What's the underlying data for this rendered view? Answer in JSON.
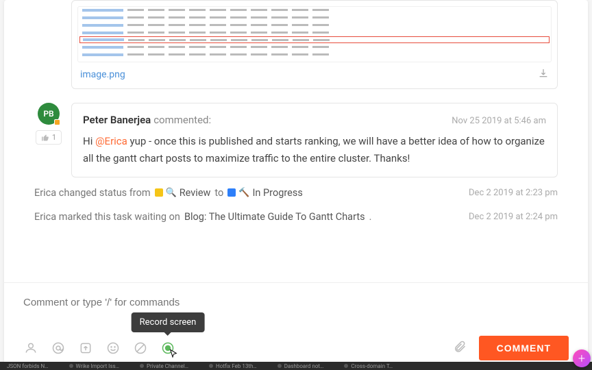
{
  "attachment": {
    "filename": "image.png"
  },
  "comment": {
    "avatar_initials": "PB",
    "author": "Peter Banerjea",
    "verb": "commented:",
    "timestamp": "Nov 25 2019 at 5:46 am",
    "like_count": "1",
    "body_prefix": "Hi ",
    "mention": "@Erica",
    "body_rest": " yup - once this is published and starts ranking, we will have a better idea of how to organize all the gantt chart posts to maximize traffic to the entire cluster. Thanks!"
  },
  "activity": {
    "status_change": {
      "actor_text": "Erica changed status from",
      "from_label": "Review",
      "to_word": "to",
      "to_label": "In Progress",
      "timestamp": "Dec 2 2019 at 2:23 pm"
    },
    "waiting": {
      "prefix": "Erica marked this task waiting on",
      "task": "Blog: The Ultimate Guide To Gantt Charts",
      "suffix": ".",
      "timestamp": "Dec 2 2019 at 2:24 pm"
    }
  },
  "composer": {
    "placeholder": "Comment or type '/' for commands",
    "tooltip": "Record screen",
    "submit_label": "COMMENT"
  },
  "tabs": {
    "t1": "JSON forbids N…",
    "t2": "Wrike Import Iss…",
    "t3": "Private Channel…",
    "t4": "Hotfix Feb 13th…",
    "t5": "Dashboard not…",
    "t6": "Cross-domain T…"
  }
}
